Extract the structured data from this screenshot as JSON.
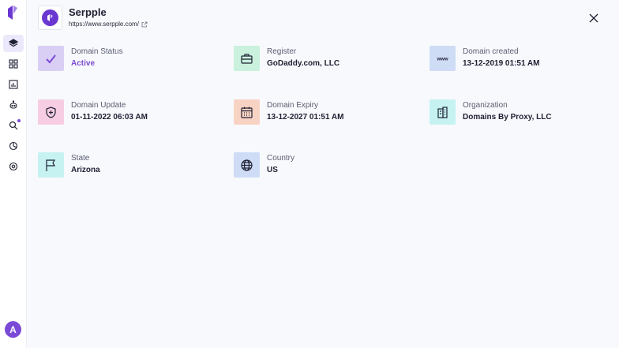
{
  "app": {
    "avatar_initial": "A"
  },
  "sidebar": {
    "items": [
      {
        "name": "layers",
        "icon": "layers-icon",
        "active": true
      },
      {
        "name": "dashboard",
        "icon": "grid-icon"
      },
      {
        "name": "reports",
        "icon": "bar-chart-icon"
      },
      {
        "name": "bot",
        "icon": "robot-icon"
      },
      {
        "name": "search",
        "icon": "search-icon",
        "has_dot": true
      },
      {
        "name": "analytics",
        "icon": "pie-chart-icon"
      },
      {
        "name": "settings",
        "icon": "gear-icon"
      }
    ]
  },
  "header": {
    "site_name": "Serpple",
    "site_url": "https://www.serpple.com/"
  },
  "details": [
    {
      "label": "Domain Status",
      "value": "Active",
      "icon": "checkmark-icon",
      "color": "#d9cff5",
      "icon_color": "#7a4ad6",
      "accent": true
    },
    {
      "label": "Register",
      "value": "GoDaddy.com, LLC",
      "icon": "briefcase-icon",
      "color": "#c9f1dd",
      "icon_color": "#1e2033"
    },
    {
      "label": "Domain created",
      "value": "13-12-2019 01:51 AM",
      "icon": "www-icon",
      "color": "#cfdcf6",
      "icon_color": "#1e2033"
    },
    {
      "label": "Domain Update",
      "value": "01-11-2022 06:03 AM",
      "icon": "shield-plus-icon",
      "color": "#f6cde3",
      "icon_color": "#1e2033"
    },
    {
      "label": "Domain Expiry",
      "value": "13-12-2027 01:51 AM",
      "icon": "calendar-icon",
      "color": "#f8d3c3",
      "icon_color": "#1e2033"
    },
    {
      "label": "Organization",
      "value": "Domains By Proxy, LLC",
      "icon": "building-icon",
      "color": "#c6f2f2",
      "icon_color": "#1e2033"
    },
    {
      "label": "State",
      "value": "Arizona",
      "icon": "flag-icon",
      "color": "#c6f2f2",
      "icon_color": "#1e2033"
    },
    {
      "label": "Country",
      "value": "US",
      "icon": "globe-icon",
      "color": "#cfdcf6",
      "icon_color": "#1e2033"
    }
  ]
}
